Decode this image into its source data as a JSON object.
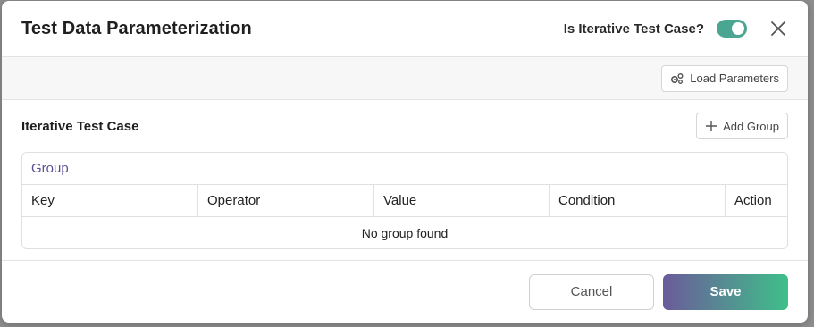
{
  "dialog": {
    "title": "Test Data Parameterization",
    "iterative_label": "Is Iterative Test Case?",
    "iterative_enabled": true,
    "close_icon": "close-icon"
  },
  "toolbar": {
    "load_parameters_label": "Load Parameters",
    "load_icon": "gears-icon"
  },
  "section": {
    "title": "Iterative Test Case",
    "add_group_label": "Add Group",
    "add_icon": "plus-icon"
  },
  "group": {
    "title": "Group",
    "columns": [
      "Key",
      "Operator",
      "Value",
      "Condition",
      "Action"
    ],
    "empty_text": "No group found"
  },
  "footer": {
    "cancel_label": "Cancel",
    "save_label": "Save"
  },
  "colors": {
    "toggle_on": "#4aa690",
    "group_title": "#5b5097",
    "save_gradient_start": "#6b5b9a",
    "save_gradient_end": "#3fbf8a"
  }
}
